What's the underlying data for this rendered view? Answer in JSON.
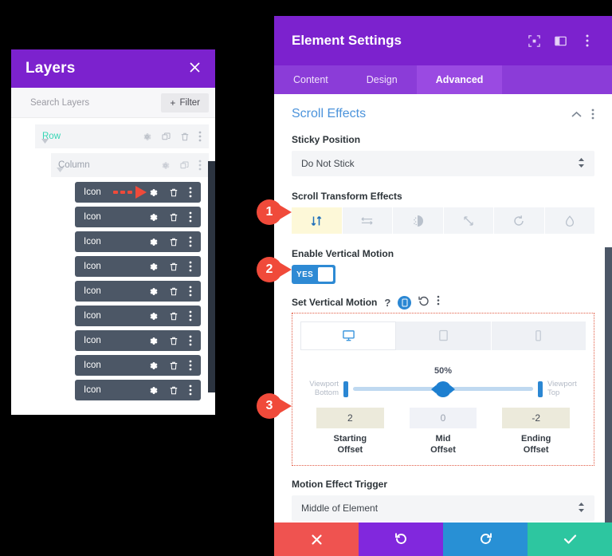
{
  "layers_panel": {
    "title": "Layers",
    "close_icon": "close-icon",
    "search_placeholder": "Search Layers",
    "filter_label": "Filter",
    "filter_plus": "+",
    "tree": [
      {
        "label": "Row",
        "level": "row"
      },
      {
        "label": "Column",
        "level": "column"
      }
    ],
    "icon_items": [
      {
        "label": "Icon"
      },
      {
        "label": "Icon"
      },
      {
        "label": "Icon"
      },
      {
        "label": "Icon"
      },
      {
        "label": "Icon"
      },
      {
        "label": "Icon"
      },
      {
        "label": "Icon"
      },
      {
        "label": "Icon"
      },
      {
        "label": "Icon"
      }
    ]
  },
  "settings": {
    "title": "Element Settings",
    "tabs": [
      {
        "label": "Content",
        "active": false
      },
      {
        "label": "Design",
        "active": false
      },
      {
        "label": "Advanced",
        "active": true
      }
    ],
    "section": {
      "title": "Scroll Effects",
      "collapse_icon": "chevron-up-icon",
      "menu_icon": "more-vertical-icon"
    },
    "sticky_position": {
      "label": "Sticky Position",
      "value": "Do Not Stick"
    },
    "scroll_transform_effects": {
      "label": "Scroll Transform Effects",
      "options": [
        {
          "name": "vertical-motion-icon",
          "active": true
        },
        {
          "name": "horizontal-motion-icon",
          "active": false
        },
        {
          "name": "fade-in-out-icon",
          "active": false
        },
        {
          "name": "scaling-up-down-icon",
          "active": false
        },
        {
          "name": "rotating-icon",
          "active": false
        },
        {
          "name": "blur-icon",
          "active": false
        }
      ]
    },
    "enable_vertical_motion": {
      "label": "Enable Vertical Motion",
      "toggle_value": "YES"
    },
    "set_vertical_motion": {
      "label": "Set Vertical Motion",
      "help_icon": "?",
      "responsive_icon": "responsive-device-icon",
      "reset_icon": "reset-icon",
      "menu_icon": "more-vertical-icon",
      "devices": [
        {
          "name": "desktop-icon",
          "active": true
        },
        {
          "name": "tablet-icon",
          "active": false
        },
        {
          "name": "phone-icon",
          "active": false
        }
      ],
      "slider": {
        "percent": "50%",
        "viewport_bottom_line1": "Viewport",
        "viewport_bottom_line2": "Bottom",
        "viewport_top_line1": "Viewport",
        "viewport_top_line2": "Top"
      },
      "offsets": [
        {
          "value": "2",
          "caption_line1": "Starting",
          "caption_line2": "Offset",
          "style": "start"
        },
        {
          "value": "0",
          "caption_line1": "Mid",
          "caption_line2": "Offset",
          "style": "mid"
        },
        {
          "value": "-2",
          "caption_line1": "Ending",
          "caption_line2": "Offset",
          "style": "end"
        }
      ]
    },
    "motion_effect_trigger": {
      "label": "Motion Effect Trigger",
      "value": "Middle of Element"
    },
    "actions": [
      {
        "name": "cancel-button",
        "icon": "close-icon",
        "color": "#ef5350"
      },
      {
        "name": "undo-button",
        "icon": "undo-icon",
        "color": "#8128dd"
      },
      {
        "name": "redo-button",
        "icon": "redo-icon",
        "color": "#2890d5"
      },
      {
        "name": "save-button",
        "icon": "check-icon",
        "color": "#2dc6a0"
      }
    ]
  },
  "callouts": [
    {
      "number": "1"
    },
    {
      "number": "2"
    },
    {
      "number": "3"
    }
  ],
  "colors": {
    "purple": "#7c22ce",
    "accent_blue": "#2b87d3",
    "callout_red": "#f04a3a",
    "active_yellow": "#fdf8d8",
    "layer_item": "#4c5766"
  }
}
